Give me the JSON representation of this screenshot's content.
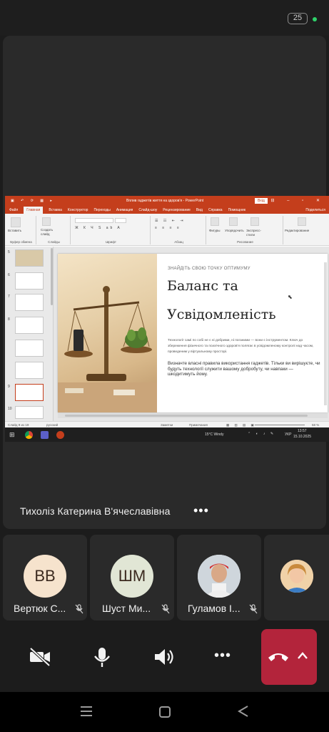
{
  "status_bar": {
    "badge": "25"
  },
  "ppt": {
    "title": "Вплив гаджетів життя на здоров'я - PowerPoint",
    "login": "Вхід",
    "tabs": [
      "Файл",
      "Главная",
      "Вставка",
      "Конструктор",
      "Переходы",
      "Анимация",
      "Слайд-шоу",
      "Рецензирование",
      "Вид",
      "Справка",
      "Помощник",
      "Поделиться"
    ],
    "active_tab": "Главная",
    "ribbon": {
      "paste": "Вставить",
      "new_slide": "Создать слайд",
      "clipboard": "Буфер обмена",
      "slides": "Слайды",
      "font": "Шрифт",
      "paragraph": "Абзац",
      "shapes": "Фигуры",
      "arrange": "Упорядочить",
      "quick_styles": "Экспресс-стили",
      "drawing": "Рисование",
      "editing": "Редактирование"
    },
    "slide_numbers": [
      "5",
      "6",
      "7",
      "8",
      "9",
      "10"
    ],
    "slide": {
      "kicker": "ЗНАЙДІТЬ СВОЮ ТОЧКУ ОПТИМУМУ",
      "title_line1": "Баланс та",
      "title_line2": "Усвідомленість",
      "body1": "Технології самі по собі не є ні добрими, ні поганими — вони є інструментом. Ключ до збереження фізичного та психічного здоров'я полягає в усвідомленому контролі над часом, проведеним у віртуальному просторі.",
      "body2": "Визначте власні правила використання гаджетів. Тільки ви вирішуєте, чи будуть технології служити вашому добробуту, чи навпаки — шкодитимуть йому."
    },
    "status": {
      "slide_of": "Слайд 9 из 19",
      "language": "русский",
      "notes": "Заметки",
      "comments": "Примечания",
      "zoom": "58 %"
    },
    "taskbar": {
      "weather": "15°C Windy",
      "lang": "УКР",
      "time": "13:57",
      "date": "15.10.2025"
    }
  },
  "presenter": {
    "name": "Тихоліз Катерина В'ячеславівна",
    "more": "•••"
  },
  "participants": [
    {
      "initials": "ВВ",
      "name": "Вертюк С...",
      "avatar_color": "#f6e3cd",
      "muted": true
    },
    {
      "initials": "ШМ",
      "name": "Шуст Ми...",
      "avatar_color": "#e1e6d5",
      "muted": true
    },
    {
      "initials": "",
      "name": "Гуламов І...",
      "avatar_color": "#d9d9d9",
      "muted": true
    },
    {
      "initials": "",
      "name": "",
      "avatar_color": "#e8c49a",
      "muted": false
    }
  ],
  "controls": {
    "camera": "camera-off-icon",
    "mic": "microphone-icon",
    "speaker": "speaker-icon",
    "more": "•••",
    "hangup": "hang-up-icon",
    "expand": "chevron-up-icon"
  },
  "colors": {
    "accent": "#c43e1c",
    "hangup": "#b3243b",
    "online": "#2fd26a"
  }
}
